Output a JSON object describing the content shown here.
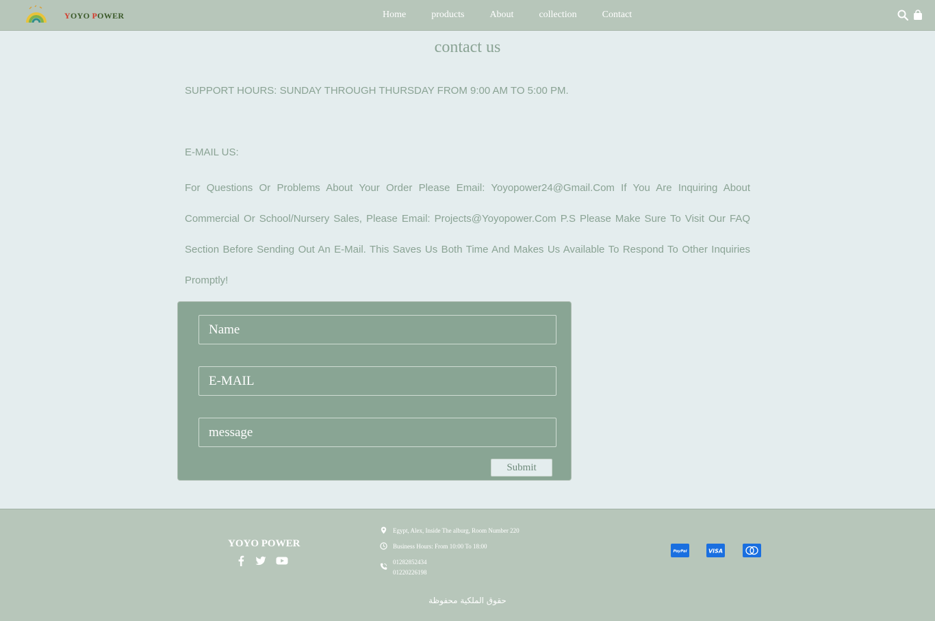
{
  "header": {
    "brand_first": "Y",
    "brand_oyo": "OYO ",
    "brand_p": "P",
    "brand_ower": "OWER",
    "nav": [
      "Home",
      "products",
      "About",
      "collection",
      "Contact"
    ]
  },
  "main": {
    "title": "contact us",
    "support_hours": "SUPPORT HOURS: SUNDAY THROUGH THURSDAY FROM 9:00 AM TO 5:00 PM.",
    "email_heading": "E-MAIL US:",
    "email_paragraph": "For Questions Or Problems About Your Order Please Email: Yoyopower24@Gmail.Com If You Are Inquiring About Commercial Or School/Nursery Sales, Please Email: Projects@Yoyopower.Com P.S Please Make Sure To Visit Our FAQ Section Before Sending Out An E-Mail. This Saves Us Both Time And Makes Us Available To Respond To Other Inquiries Promptly!"
  },
  "form": {
    "name_placeholder": "Name",
    "email_placeholder": "E-MAIL",
    "message_placeholder": "message",
    "submit_label": "Submit"
  },
  "footer": {
    "brand": "YOYO POWER",
    "address": "Egypt, Alex, Inside The alburg, Room Number 220",
    "hours": "Business Hours: From 10:00 To 18:00",
    "phone1": "01282852434",
    "phone2": "01220226198",
    "copyright": "حقوق الملكية محفوظة",
    "payment_icons": [
      "paypal-icon",
      "visa-icon",
      "mastercard-icon"
    ]
  },
  "colors": {
    "header_bg": "#b7c6ba",
    "page_bg": "#e4edee",
    "form_bg": "#89a594",
    "text_accent": "#8aa394",
    "payment_blue": "#1a6fe0"
  }
}
